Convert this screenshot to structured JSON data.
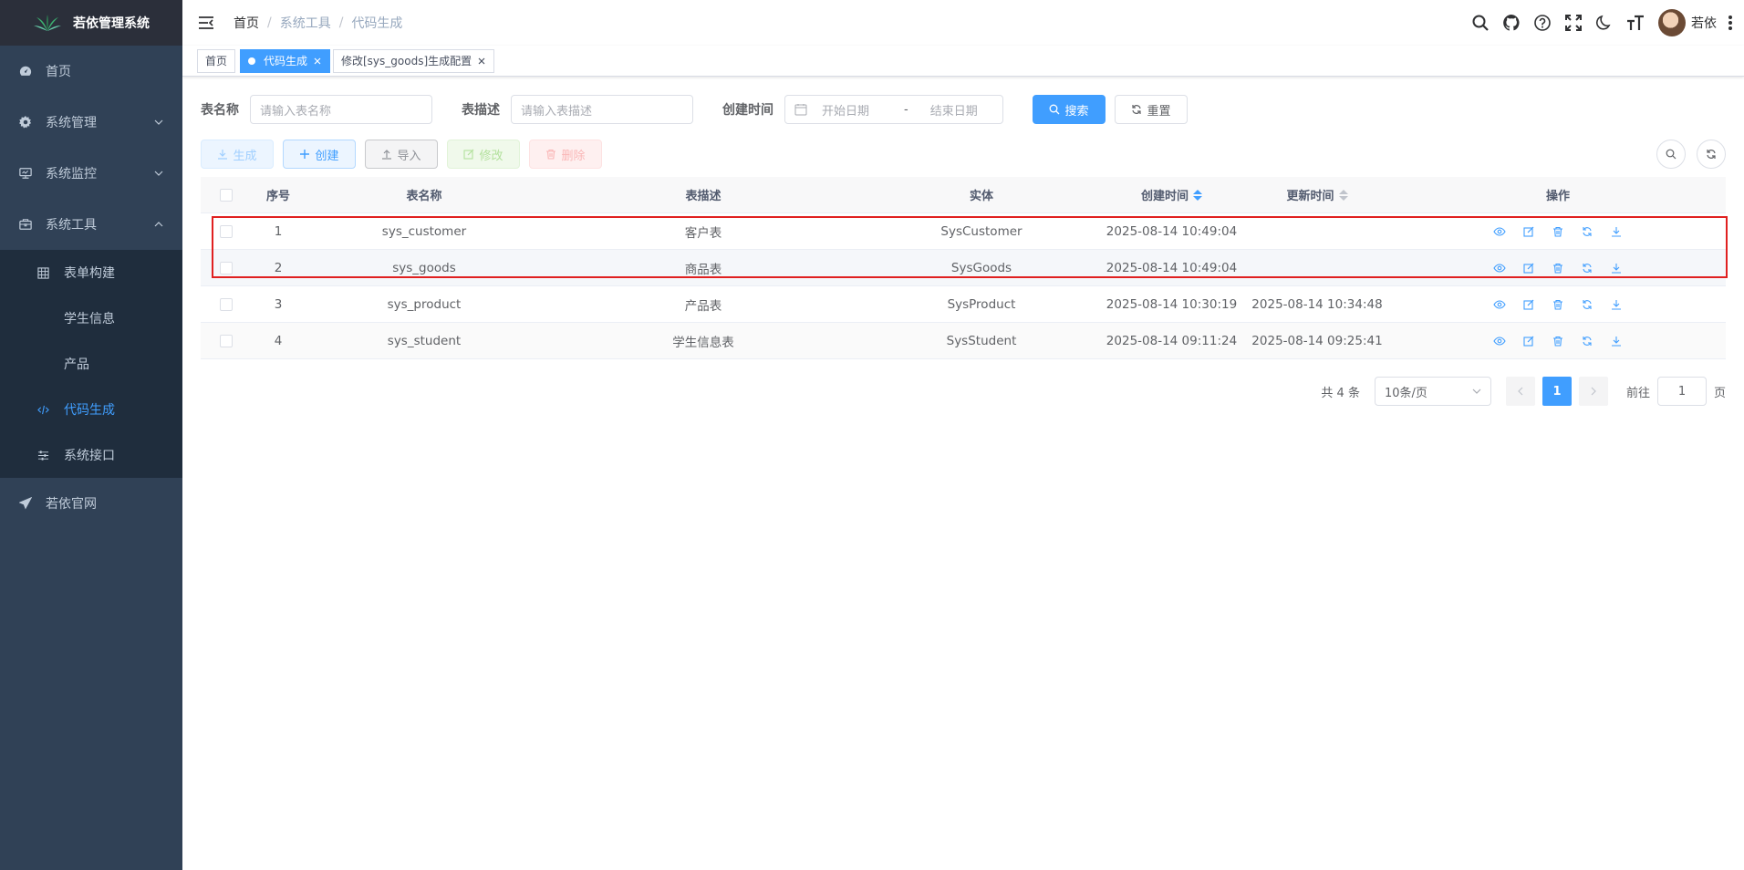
{
  "app": {
    "title": "若依管理系统"
  },
  "sidebar": {
    "items": [
      {
        "label": "首页",
        "icon": "dashboard-icon"
      },
      {
        "label": "系统管理",
        "icon": "gear-icon"
      },
      {
        "label": "系统监控",
        "icon": "monitor-icon"
      },
      {
        "label": "系统工具",
        "icon": "toolbox-icon"
      },
      {
        "label": "若依官网",
        "icon": "send-icon"
      }
    ],
    "sub_items": [
      {
        "label": "表单构建",
        "icon": "table-icon"
      },
      {
        "label": "学生信息"
      },
      {
        "label": "产品"
      },
      {
        "label": "代码生成",
        "icon": "code-icon"
      },
      {
        "label": "系统接口",
        "icon": "sliders-icon"
      }
    ]
  },
  "navbar": {
    "breadcrumb": [
      "首页",
      "系统工具",
      "代码生成"
    ],
    "user_name": "若依"
  },
  "tags": [
    {
      "label": "首页"
    },
    {
      "label": "代码生成"
    },
    {
      "label": "修改[sys_goods]生成配置"
    }
  ],
  "search": {
    "table_name_label": "表名称",
    "table_name_placeholder": "请输入表名称",
    "table_desc_label": "表描述",
    "table_desc_placeholder": "请输入表描述",
    "create_time_label": "创建时间",
    "start_placeholder": "开始日期",
    "range_sep": "-",
    "end_placeholder": "结束日期",
    "search_btn": "搜索",
    "reset_btn": "重置"
  },
  "toolbar": {
    "generate": "生成",
    "create": "创建",
    "import": "导入",
    "edit": "修改",
    "delete": "删除"
  },
  "table": {
    "headers": {
      "index": "序号",
      "name": "表名称",
      "desc": "表描述",
      "entity": "实体",
      "created": "创建时间",
      "updated": "更新时间",
      "ops": "操作"
    },
    "rows": [
      {
        "index": "1",
        "name": "sys_customer",
        "desc": "客户表",
        "entity": "SysCustomer",
        "created": "2025-08-14 10:49:04",
        "updated": ""
      },
      {
        "index": "2",
        "name": "sys_goods",
        "desc": "商品表",
        "entity": "SysGoods",
        "created": "2025-08-14 10:49:04",
        "updated": ""
      },
      {
        "index": "3",
        "name": "sys_product",
        "desc": "产品表",
        "entity": "SysProduct",
        "created": "2025-08-14 10:30:19",
        "updated": "2025-08-14 10:34:48"
      },
      {
        "index": "4",
        "name": "sys_student",
        "desc": "学生信息表",
        "entity": "SysStudent",
        "created": "2025-08-14 09:11:24",
        "updated": "2025-08-14 09:25:41"
      }
    ]
  },
  "pagination": {
    "total": "共 4 条",
    "page_size": "10条/页",
    "current": "1",
    "goto_label": "前往",
    "goto_value": "1",
    "page_unit": "页"
  },
  "colors": {
    "primary": "#409eff",
    "sidebar_bg": "#304156",
    "highlight": "#e02020"
  }
}
